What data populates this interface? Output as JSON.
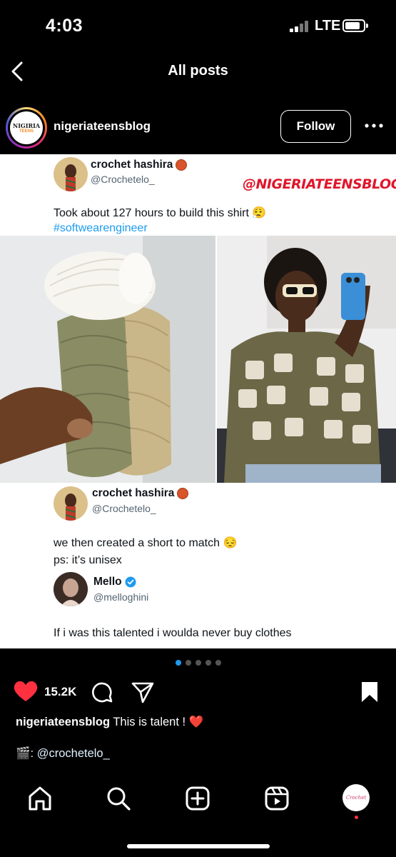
{
  "status_bar": {
    "time": "4:03",
    "network": "LTE",
    "battery_level": 0.85
  },
  "nav": {
    "title": "All posts"
  },
  "post": {
    "username": "nigeriateensblog",
    "avatar_logo": {
      "line1": "NIGIRIA",
      "line2": "TEENS"
    },
    "follow_label": "Follow"
  },
  "media": {
    "watermark": "@NIGERIATEENSBLOG",
    "tweet1": {
      "name": "crochet hashira",
      "handle": "@Crochetelo_",
      "text": "Took about 127 hours to build this shirt 😮‍💨",
      "hashtag": "#softwearengineer"
    },
    "tweet2": {
      "name": "crochet hashira",
      "handle": "@Crochetelo_",
      "line1": "we then created a short to match 😔",
      "line2": "ps: it’s unisex"
    },
    "quote": {
      "name": "Mello",
      "handle": "@melloghini",
      "text": "If i was this talented i woulda never buy clothes"
    }
  },
  "carousel": {
    "count": 5,
    "active_index": 0,
    "active_color": "#1d9bf0"
  },
  "actions": {
    "like_count": "15.2K",
    "like_color": "#ff3040"
  },
  "caption": {
    "username": "nigeriateensblog",
    "text": "This is talent ! ❤️",
    "credit_prefix": "🎬: ",
    "credit_handle": "@crochetelo_"
  },
  "tab_bar": {
    "profile_avatar_text": "Crochet"
  }
}
